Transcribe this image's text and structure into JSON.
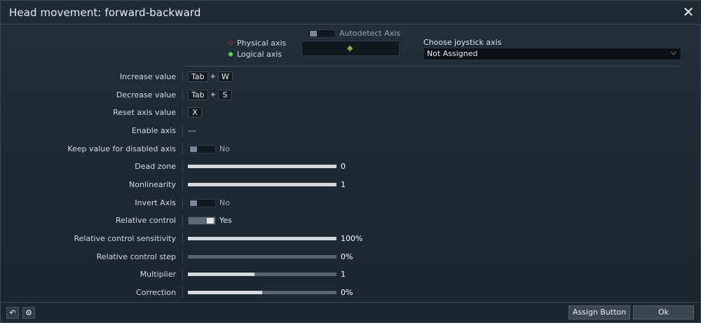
{
  "dialog": {
    "title": "Head movement: forward-backward",
    "close_icon": "close-icon"
  },
  "legend": {
    "physical_axis": "Physical axis",
    "logical_axis": "Logical axis",
    "physical_color": "#e0312b",
    "logical_color": "#5cd64b"
  },
  "autodetect": {
    "label": "Autodetect Axis",
    "on": false
  },
  "joystick": {
    "label": "Choose joystick axis",
    "selected": "Not Assigned"
  },
  "rows": {
    "increase": {
      "label": "Increase value",
      "keys": [
        "Tab",
        "W"
      ],
      "plus": "+"
    },
    "decrease": {
      "label": "Decrease value",
      "keys": [
        "Tab",
        "S"
      ],
      "plus": "+"
    },
    "reset": {
      "label": "Reset axis value",
      "key": "X"
    },
    "enable": {
      "label": "Enable axis",
      "value": "---"
    },
    "keep": {
      "label": "Keep value for disabled axis",
      "value": "No",
      "on": false
    },
    "deadzone": {
      "label": "Dead zone",
      "value": "0",
      "fill": 1.0
    },
    "nonlinearity": {
      "label": "Nonlinearity",
      "value": "1",
      "fill": 1.0
    },
    "invert": {
      "label": "Invert Axis",
      "value": "No",
      "on": false
    },
    "relative": {
      "label": "Relative control",
      "value": "Yes",
      "on": true
    },
    "rel_sens": {
      "label": "Relative control sensitivity",
      "value": "100%",
      "fill": 1.0
    },
    "rel_step": {
      "label": "Relative control step",
      "value": "0%",
      "fill": 0.0
    },
    "multiplier": {
      "label": "Multiplier",
      "value": "1",
      "fill": 0.45
    },
    "correction": {
      "label": "Correction",
      "value": "0%",
      "fill": 0.5
    }
  },
  "footer": {
    "assign_button": "Assign Button",
    "ok_button": "Ok",
    "undo_icon": "undo-icon",
    "joystick_settings_icon": "joystick-settings-icon"
  },
  "colors": {
    "accent_slider": "#d4d9dd",
    "track": "#59646f"
  }
}
